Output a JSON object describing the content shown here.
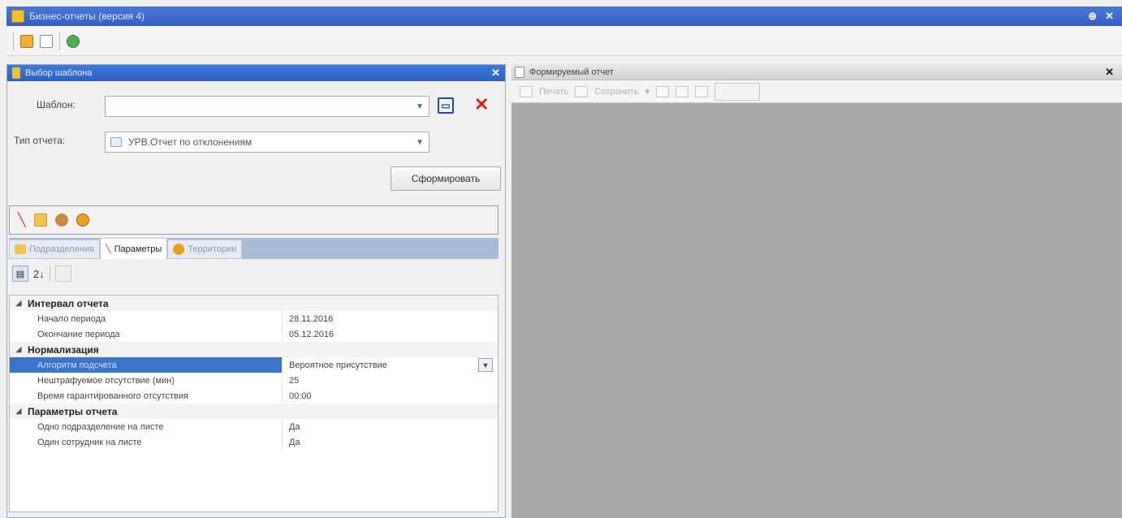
{
  "app": {
    "title": "Бизнес-отчеты (версия 4)",
    "title_buttons": [
      "⊕",
      "✕"
    ]
  },
  "left_panel": {
    "title": "Выбор шаблона",
    "template_label": "Шаблон:",
    "template_value": "",
    "report_type_label": "Тип отчета:",
    "report_type_value": "УРВ.Отчет по отклонениям",
    "generate_button": "Сформировать",
    "tabs": [
      {
        "label": "Подразделения",
        "active": false
      },
      {
        "label": "Параметры",
        "active": true
      },
      {
        "label": "Территории",
        "active": false
      }
    ],
    "sort_icon_label": "2↓",
    "categories": [
      {
        "name": "Интервал отчета",
        "props": [
          {
            "name": "Начало периода",
            "value": "28.11.2016"
          },
          {
            "name": "Окончание периода",
            "value": "05.12.2016"
          }
        ]
      },
      {
        "name": "Нормализация",
        "props": [
          {
            "name": "Алгоритм подсчета",
            "value": "Вероятное присутствие",
            "selected": true
          },
          {
            "name": "Нештрафуемое отсутствие (мин)",
            "value": "25"
          },
          {
            "name": "Время гарантированного отсутствия",
            "value": "00:00"
          }
        ]
      },
      {
        "name": "Параметры отчета",
        "props": [
          {
            "name": "Одно подразделение на листе",
            "value": "Да"
          },
          {
            "name": "Один сотрудник на листе",
            "value": "Да"
          }
        ]
      }
    ]
  },
  "right_panel": {
    "title": "Формируемый отчет",
    "print_label": "Печать",
    "save_label": "Сохранить",
    "background_color": "#a9a9a9"
  },
  "colors": {
    "title_blue": "#3560c0",
    "selection_blue": "#3a75c9"
  }
}
